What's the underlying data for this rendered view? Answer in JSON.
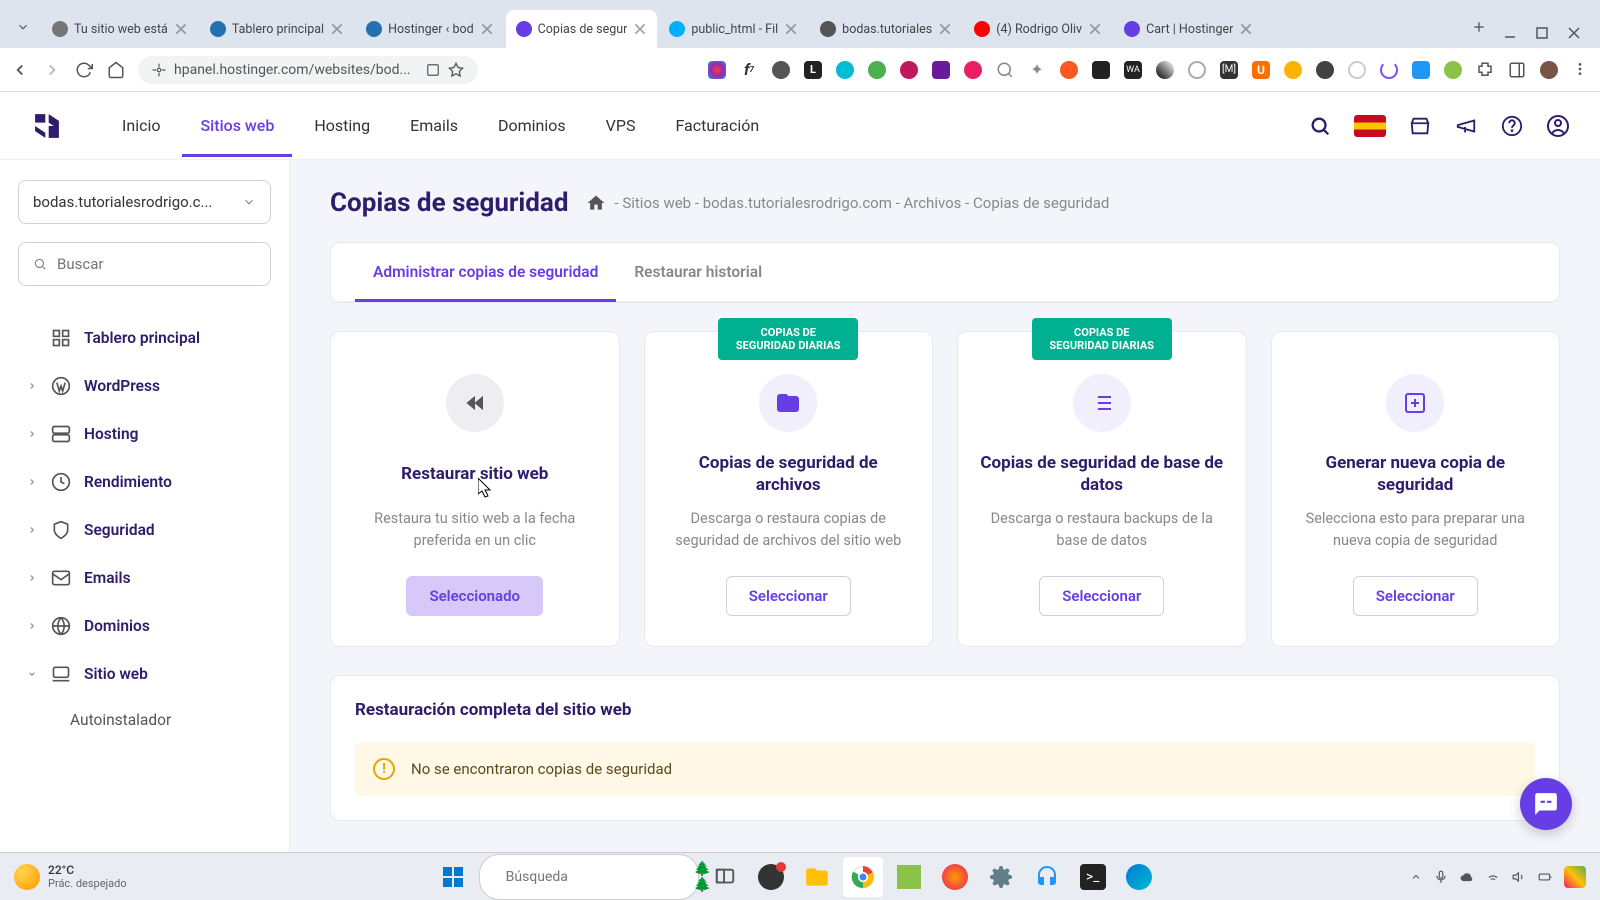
{
  "browser": {
    "tabs": [
      {
        "title": "Tu sitio web está",
        "color": "#757575"
      },
      {
        "title": "Tablero principal",
        "color": "#2271b1"
      },
      {
        "title": "Hostinger ‹ bod",
        "color": "#2271b1"
      },
      {
        "title": "Copias de segur",
        "color": "#673de6",
        "active": true
      },
      {
        "title": "public_html - Fil",
        "color": "#00b0ff"
      },
      {
        "title": "bodas.tutoriales",
        "color": "#555"
      },
      {
        "title": "(4) Rodrigo Oliv",
        "color": "#ff0000"
      },
      {
        "title": "Cart | Hostinger",
        "color": "#673de6"
      }
    ],
    "url": "hpanel.hostinger.com/websites/bod..."
  },
  "topnav": {
    "items": [
      "Inicio",
      "Sitios web",
      "Hosting",
      "Emails",
      "Dominios",
      "VPS",
      "Facturación"
    ],
    "active_index": 1
  },
  "sidebar": {
    "site_selected": "bodas.tutorialesrodrigo.c...",
    "search_placeholder": "Buscar",
    "items": [
      {
        "label": "Tablero principal",
        "icon": "dashboard",
        "nochevron": true
      },
      {
        "label": "WordPress",
        "icon": "wordpress"
      },
      {
        "label": "Hosting",
        "icon": "server"
      },
      {
        "label": "Rendimiento",
        "icon": "speed"
      },
      {
        "label": "Seguridad",
        "icon": "shield"
      },
      {
        "label": "Emails",
        "icon": "mail"
      },
      {
        "label": "Dominios",
        "icon": "globe"
      },
      {
        "label": "Sitio web",
        "icon": "laptop",
        "expanded": true
      }
    ],
    "subitems": [
      "Autoinstalador"
    ]
  },
  "page": {
    "title": "Copias de seguridad",
    "breadcrumb": "- Sitios web - bodas.tutorialesrodrigo.com - Archivos - Copias de seguridad",
    "tabs": [
      "Administrar copias de seguridad",
      "Restaurar historial"
    ],
    "active_tab": 0
  },
  "cards": [
    {
      "title": "Restaurar sitio web",
      "desc": "Restaura tu sitio web a la fecha preferida en un clic",
      "button": "Seleccionado",
      "selected": true,
      "badge": ""
    },
    {
      "title": "Copias de seguridad de archivos",
      "desc": "Descarga o restaura copias de seguridad de archivos del sitio web",
      "button": "Seleccionar",
      "badge": "COPIAS DE SEGURIDAD DIARIAS"
    },
    {
      "title": "Copias de seguridad de base de datos",
      "desc": "Descarga o restaura backups de la base de datos",
      "button": "Seleccionar",
      "badge": "COPIAS DE SEGURIDAD DIARIAS"
    },
    {
      "title": "Generar nueva copia de seguridad",
      "desc": "Selecciona esto para preparar una nueva copia de seguridad",
      "button": "Seleccionar",
      "badge": ""
    }
  ],
  "restore_section": {
    "title": "Restauración completa del sitio web",
    "alert": "No se encontraron copias de seguridad"
  },
  "taskbar": {
    "weather_temp": "22°C",
    "weather_desc": "Prác. despejado",
    "search_placeholder": "Búsqueda"
  }
}
